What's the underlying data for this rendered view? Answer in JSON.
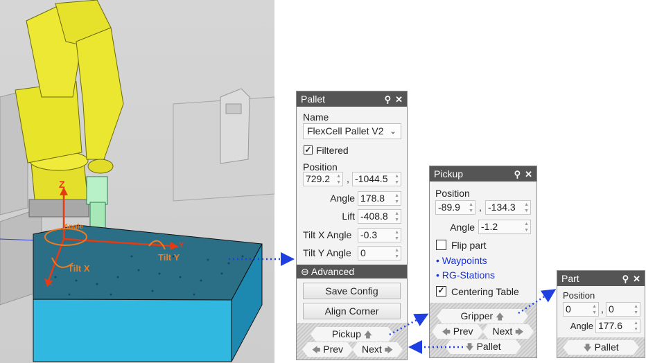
{
  "scene": {
    "axis_z": "Z",
    "axis_y": "Y",
    "axis_x": "X",
    "label_angle": "Angle",
    "label_tilt_x": "Tilt X",
    "label_tilt_y": "Tilt Y",
    "colors": {
      "robot": "#e8e42a",
      "gripper": "#b8f0c8",
      "table_top": "#2a6f86",
      "table_side": "#30b8e0",
      "axis": "#e63b12",
      "gizmo": "#f07a20"
    }
  },
  "pallet": {
    "title": "Pallet",
    "name_label": "Name",
    "name_value": "FlexCell Pallet V2",
    "filtered_label": "Filtered",
    "filtered_checked": true,
    "position_label": "Position",
    "pos_x": "729.2",
    "pos_y": "-1044.5",
    "comma": ",",
    "angle_label": "Angle",
    "angle_value": "178.8",
    "lift_label": "Lift",
    "lift_value": "-408.8",
    "tilt_x_label": "Tilt X Angle",
    "tilt_x_value": "-0.3",
    "tilt_y_label": "Tilt Y Angle",
    "tilt_y_value": "0",
    "advanced_label": "Advanced",
    "save_config": "Save Config",
    "align_corner": "Align Corner",
    "nav_pickup": "Pickup",
    "nav_prev": "Prev",
    "nav_next": "Next"
  },
  "pickup": {
    "title": "Pickup",
    "position_label": "Position",
    "pos_x": "-89.9",
    "pos_y": "-134.3",
    "comma": ",",
    "angle_label": "Angle",
    "angle_value": "-1.2",
    "flip_label": "Flip part",
    "flip_checked": false,
    "waypoints_link": "Waypoints",
    "rgstations_link": "RG-Stations",
    "centering_label": "Centering Table",
    "centering_checked": true,
    "nav_gripper": "Gripper",
    "nav_prev": "Prev",
    "nav_next": "Next",
    "nav_pallet": "Pallet"
  },
  "part": {
    "title": "Part",
    "position_label": "Position",
    "pos_x": "0",
    "pos_y": "0",
    "comma": ",",
    "angle_label": "Angle",
    "angle_value": "177.6",
    "nav_pallet": "Pallet"
  },
  "icons": {
    "pin": "pin-icon",
    "close": "close-icon",
    "collapse": "collapse-circle-icon",
    "arrow_up": "arrow-up-icon",
    "arrow_down": "arrow-down-icon",
    "arrow_left": "arrow-left-icon",
    "arrow_right": "arrow-right-icon"
  }
}
